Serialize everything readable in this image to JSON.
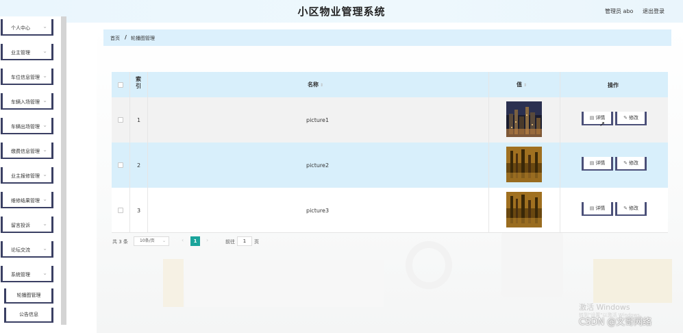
{
  "header": {
    "title": "小区物业管理系统",
    "user": "管理员 abo",
    "logout": "退出登录"
  },
  "sidebar": {
    "items": [
      {
        "label": "个人中心",
        "icon": "chevron-down-icon"
      },
      {
        "label": "业主管理",
        "icon": "chevron-down-icon"
      },
      {
        "label": "车位信息管理",
        "icon": "chevron-down-icon"
      },
      {
        "label": "车辆入场管理",
        "icon": "chevron-down-icon"
      },
      {
        "label": "车辆出场管理",
        "icon": "chevron-down-icon"
      },
      {
        "label": "缴费信息管理",
        "icon": "chevron-down-icon"
      },
      {
        "label": "业主报修管理",
        "icon": "chevron-down-icon"
      },
      {
        "label": "维修结果管理",
        "icon": "chevron-down-icon"
      },
      {
        "label": "留言投诉",
        "icon": "chevron-down-icon"
      },
      {
        "label": "论坛交流",
        "icon": "chevron-down-icon"
      },
      {
        "label": "系统管理",
        "icon": "chevron-down-icon"
      }
    ],
    "sub_items": [
      {
        "label": "轮播图管理"
      },
      {
        "label": "公告信息"
      }
    ]
  },
  "breadcrumb": {
    "home": "首页",
    "separator": "/",
    "current": "轮播图管理"
  },
  "table": {
    "headers": {
      "index": "索\n引",
      "name": "名称",
      "value": "值",
      "action": "操作"
    },
    "sort_icon": "sort-icon",
    "rows": [
      {
        "index": "1",
        "name": "picture1",
        "image": "night-city-thumbnail",
        "detail": "详情",
        "edit": "修改"
      },
      {
        "index": "2",
        "name": "picture2",
        "image": "golden-city-thumbnail",
        "detail": "详情",
        "edit": "修改"
      },
      {
        "index": "3",
        "name": "picture3",
        "image": "golden-city-thumbnail",
        "detail": "详情",
        "edit": "修改"
      }
    ]
  },
  "pagination": {
    "total": "共 3 条",
    "page_size": "10条/页",
    "current_page": "1",
    "goto_label": "前往",
    "goto_value": "1",
    "page_label": "页"
  },
  "watermarks": {
    "activate": "激活 Windows",
    "activate_sub": "转到\"设置\"以激活 Windows。",
    "csdn": "CSDN @文哥网络"
  },
  "colors": {
    "header_bg": "#eaf6fd",
    "sidebar_border": "#3a3f63",
    "table_head_bg": "#d8effb",
    "row_alt_bg": "#f2f2f2",
    "pager_active": "#1aa49b"
  }
}
